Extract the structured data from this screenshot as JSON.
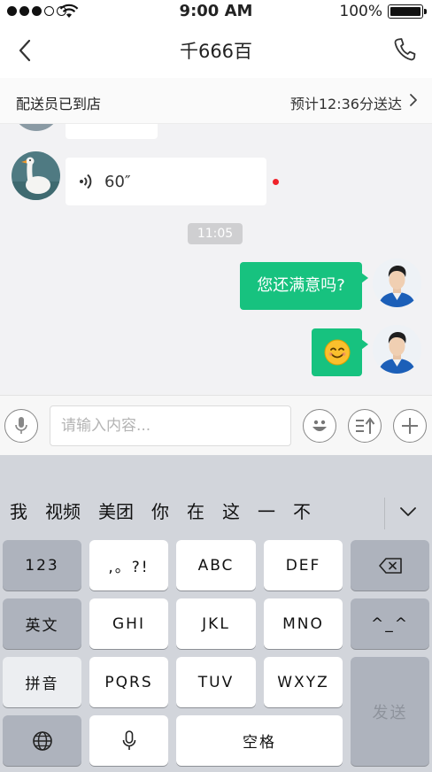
{
  "status_bar": {
    "time": "9:00 AM",
    "battery": "100%"
  },
  "nav": {
    "title": "千666百"
  },
  "delivery": {
    "status": "配送员已到店",
    "eta": "预计12:36分送达"
  },
  "chat": {
    "voice_message": {
      "duration": "60″"
    },
    "timestamp": "11:05",
    "outgoing": [
      {
        "text": "您还满意吗?"
      },
      {
        "emoji": "😊"
      }
    ]
  },
  "input": {
    "placeholder": "请输入内容..."
  },
  "keyboard": {
    "candidates": [
      "我",
      "视频",
      "美团",
      "你",
      "在",
      "这",
      "一",
      "不"
    ],
    "keys": {
      "num": "123",
      "punct": ",。?!",
      "abc": "ABC",
      "def": "DEF",
      "english": "英文",
      "ghi": "GHI",
      "jkl": "JKL",
      "mno": "MNO",
      "emoticon": "^_^",
      "pinyin": "拼音",
      "pqrs": "PQRS",
      "tuv": "TUV",
      "wxyz": "WXYZ",
      "send": "发送",
      "space": "空格"
    }
  },
  "colors": {
    "accent": "#17c27f",
    "unread": "#f0222a",
    "keyboard_bg": "#d2d5db"
  }
}
